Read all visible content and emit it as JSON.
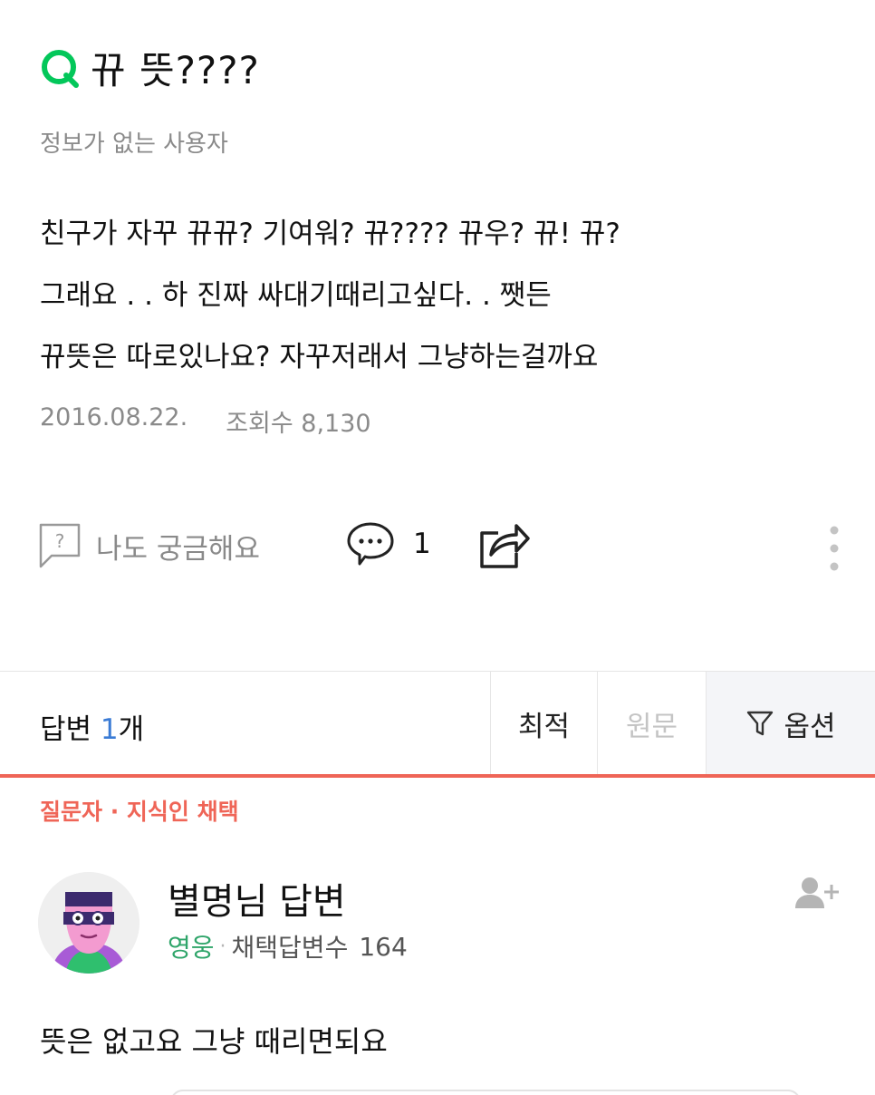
{
  "question": {
    "title": "뀨 뜻????",
    "author": "정보가 없는 사용자",
    "body_lines": [
      "친구가 자꾸 뀨뀨? 기여워? 뀨???? 뀨우? 뀨! 뀨?",
      "그래요 . . 하 진짜 싸대기때리고싶다. . 쨋든",
      "뀨뜻은 따로있나요? 자꾸저래서 그냥하는걸까요"
    ],
    "date": "2016.08.22.",
    "views": "조회수 8,130"
  },
  "actions": {
    "curious_label": "나도 궁금해요",
    "comment_count": "1"
  },
  "answers_bar": {
    "label_prefix": "답변 ",
    "count": "1",
    "label_suffix": "개",
    "sort_best": "최적",
    "sort_original": "원문",
    "option": "옵션"
  },
  "answer": {
    "chosen_label": "질문자 · 지식인 채택",
    "author_name": "별명님 답변",
    "rank": "영웅",
    "adopted_label": "채택답변수",
    "adopted_count": "164",
    "body": "뜻은 없고요 그냥 때리면되요"
  },
  "colors": {
    "brand_green": "#03c75a",
    "accent_red": "#ef6557",
    "link_blue": "#3a7bd5",
    "rank_green": "#2fa56a"
  },
  "icons": {
    "question": "q-icon",
    "curious": "question-bubble-icon",
    "comment": "comment-icon",
    "share": "share-icon",
    "more": "more-vertical-icon",
    "filter": "filter-icon",
    "follow": "add-user-icon"
  }
}
